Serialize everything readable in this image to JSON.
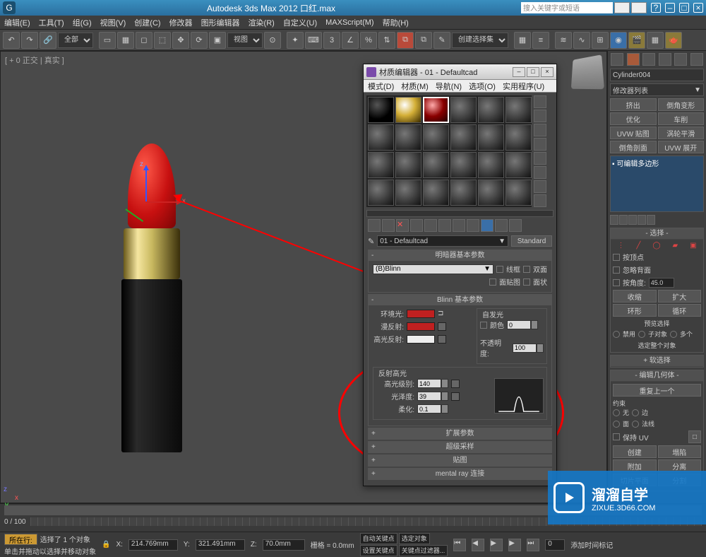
{
  "titlebar": {
    "app": "Autodesk 3ds Max 2012",
    "file": "口红.max",
    "search_placeholder": "搜入关键字或短语"
  },
  "menubar": [
    "编辑(E)",
    "工具(T)",
    "组(G)",
    "视图(V)",
    "创建(C)",
    "修改器",
    "图形编辑器",
    "渲染(R)",
    "自定义(U)",
    "MAXScript(M)",
    "帮助(H)"
  ],
  "toolbar": {
    "scope": "全部",
    "mode": "视图",
    "selset": "创建选择集"
  },
  "viewport": {
    "label": "[ + 0 正交 | 真实 ]"
  },
  "mated": {
    "title": "材质编辑器 - 01 - Defaultcad",
    "menu": [
      "模式(D)",
      "材质(M)",
      "导航(N)",
      "选项(O)",
      "实用程序(U)"
    ],
    "name": "01 - Defaultcad",
    "type_btn": "Standard",
    "shader_hdr": "明暗器基本参数",
    "shader_drop": "(B)Blinn",
    "opt_wire": "线框",
    "opt_2side": "双面",
    "opt_facemap": "面贴图",
    "opt_facet": "面状",
    "blinn_hdr": "Blinn 基本参数",
    "lbl_ambient": "环境光:",
    "lbl_diffuse": "漫反射:",
    "lbl_specular": "高光反射:",
    "self_illum": "自发光",
    "lbl_color": "颜色",
    "val_color": "0",
    "lbl_opacity": "不透明度:",
    "val_opacity": "100",
    "spec_hdr": "反射高光",
    "lbl_speclevel": "高光级别:",
    "val_speclevel": "140",
    "lbl_gloss": "光泽度:",
    "val_gloss": "39",
    "lbl_soften": "柔化:",
    "val_soften": "0.1",
    "roll_ext": "扩展参数",
    "roll_super": "超级采样",
    "roll_maps": "贴图",
    "roll_mray": "mental ray 连接"
  },
  "cmd": {
    "obj_name": "Cylinder004",
    "mod_list_label": "修改器列表",
    "btn_extrude": "挤出",
    "btn_bevel": "倒角变形",
    "btn_opt": "优化",
    "btn_lathe": "车削",
    "btn_uvw": "UVW 贴图",
    "btn_turbo": "涡轮平滑",
    "btn_chamfer": "倒角剖面",
    "btn_unwrap": "UVW 展开",
    "stack_item": "可编辑多边形",
    "roll_sel": "选择",
    "chk_vertex": "按顶点",
    "chk_ignore": "忽略背面",
    "chk_angle": "按角度:",
    "val_angle": "45.0",
    "btn_shrink": "收缩",
    "btn_grow": "扩大",
    "btn_ring": "环形",
    "btn_loop": "循环",
    "preview_hdr": "预览选择",
    "rb_off": "禁用",
    "rb_sub": "子对象",
    "rb_multi": "多个",
    "sel_whole": "选定整个对象",
    "roll_soft": "软选择",
    "roll_editgeo": "编辑几何体",
    "btn_repeat": "重复上一个",
    "lbl_constrain": "约束",
    "rb_none": "无",
    "rb_edge": "边",
    "rb_face": "面",
    "rb_normal": "法线",
    "chk_uv": "保持 UV",
    "btn_create": "创建",
    "btn_collapse": "塌陷",
    "btn_attach": "附加",
    "btn_detach": "分离",
    "btn_slice": "切片平面",
    "btn_split": "分割"
  },
  "timeline": {
    "range": "0 / 100",
    "frame": "0"
  },
  "status": {
    "sel": "选择了 1 个对象",
    "hint": "单击并拖动以选择并移动对象",
    "btn_row": "所在行:",
    "x": "214.769mm",
    "y": "321.491mm",
    "z": "70.0mm",
    "grid": "栅格 = 0.0mm",
    "autokey": "自动关键点",
    "selkey": "选定对象",
    "setkey": "设置关键点",
    "keyfilter": "关键点过滤器...",
    "addtag": "添加时间标记"
  },
  "watermark": {
    "brand": "溜溜自学",
    "url": "ZIXUE.3D66.COM"
  }
}
